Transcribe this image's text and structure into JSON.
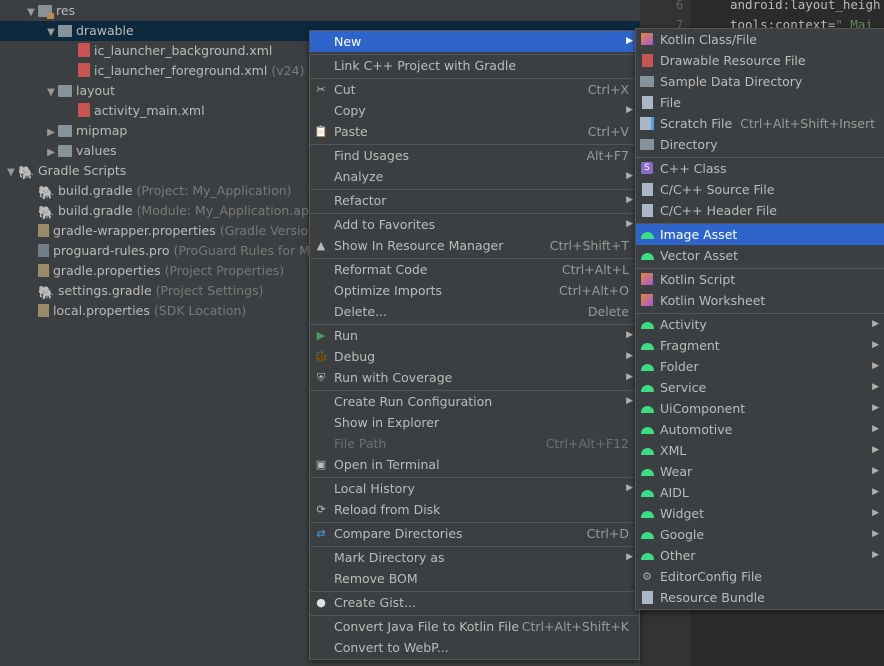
{
  "tree": {
    "rows": [
      {
        "label": "res",
        "hint": "",
        "arrow": "▼",
        "indent": 1,
        "icon": "res-folder-icon",
        "kind": "res"
      },
      {
        "label": "drawable",
        "hint": "",
        "arrow": "▼",
        "indent": 2,
        "icon": "folder-icon",
        "kind": "folder",
        "selected": true
      },
      {
        "label": "ic_launcher_background.xml",
        "hint": "",
        "arrow": "",
        "indent": 3,
        "icon": "xml-file-icon",
        "kind": "xml"
      },
      {
        "label": "ic_launcher_foreground.xml",
        "hint": "(v24)",
        "arrow": "",
        "indent": 3,
        "icon": "xml-file-icon",
        "kind": "xml"
      },
      {
        "label": "layout",
        "hint": "",
        "arrow": "▼",
        "indent": 2,
        "icon": "folder-icon",
        "kind": "folder"
      },
      {
        "label": "activity_main.xml",
        "hint": "",
        "arrow": "",
        "indent": 3,
        "icon": "xml-file-icon",
        "kind": "xml"
      },
      {
        "label": "mipmap",
        "hint": "",
        "arrow": "▶",
        "indent": 2,
        "icon": "folder-icon",
        "kind": "folder"
      },
      {
        "label": "values",
        "hint": "",
        "arrow": "▶",
        "indent": 2,
        "icon": "folder-icon",
        "kind": "folder"
      },
      {
        "label": "Gradle Scripts",
        "hint": "",
        "arrow": "▼",
        "indent": 0,
        "icon": "gradle-icon",
        "kind": "gradle"
      },
      {
        "label": "build.gradle",
        "hint": "(Project: My_Application)",
        "arrow": "",
        "indent": 1,
        "icon": "gradle-icon",
        "kind": "gradle"
      },
      {
        "label": "build.gradle",
        "hint": "(Module: My_Application.app)",
        "arrow": "",
        "indent": 1,
        "icon": "gradle-icon",
        "kind": "gradle"
      },
      {
        "label": "gradle-wrapper.properties",
        "hint": "(Gradle Version)",
        "arrow": "",
        "indent": 1,
        "icon": "properties-file-icon",
        "kind": "prop"
      },
      {
        "label": "proguard-rules.pro",
        "hint": "(ProGuard Rules for My_",
        "arrow": "",
        "indent": 1,
        "icon": "proguard-file-icon",
        "kind": "proguard"
      },
      {
        "label": "gradle.properties",
        "hint": "(Project Properties)",
        "arrow": "",
        "indent": 1,
        "icon": "properties-file-icon",
        "kind": "prop"
      },
      {
        "label": "settings.gradle",
        "hint": "(Project Settings)",
        "arrow": "",
        "indent": 1,
        "icon": "gradle-icon",
        "kind": "gradle"
      },
      {
        "label": "local.properties",
        "hint": "(SDK Location)",
        "arrow": "",
        "indent": 1,
        "icon": "properties-file-icon",
        "kind": "prop"
      }
    ]
  },
  "editor": {
    "line_numbers": [
      "6",
      "7"
    ],
    "lines": [
      {
        "text": "android:layout_heigh",
        "value": ""
      },
      {
        "text": "tools:context=",
        "value": "\" Mai"
      }
    ]
  },
  "context_menu": {
    "items": [
      {
        "label": "New",
        "shortcut": "",
        "submenu": true,
        "active": true,
        "icon": ""
      },
      {
        "sep": true
      },
      {
        "label": "Link C++ Project with Gradle",
        "shortcut": "",
        "icon": ""
      },
      {
        "sep": true
      },
      {
        "label": "Cut",
        "shortcut": "Ctrl+X",
        "icon": "scissors-icon"
      },
      {
        "label": "Copy",
        "shortcut": "",
        "submenu": true,
        "icon": ""
      },
      {
        "label": "Paste",
        "shortcut": "Ctrl+V",
        "icon": "clipboard-icon"
      },
      {
        "sep": true
      },
      {
        "label": "Find Usages",
        "shortcut": "Alt+F7",
        "icon": ""
      },
      {
        "label": "Analyze",
        "shortcut": "",
        "submenu": true,
        "icon": ""
      },
      {
        "sep": true
      },
      {
        "label": "Refactor",
        "shortcut": "",
        "submenu": true,
        "icon": ""
      },
      {
        "sep": true
      },
      {
        "label": "Add to Favorites",
        "shortcut": "",
        "submenu": true,
        "icon": ""
      },
      {
        "label": "Show In Resource Manager",
        "shortcut": "Ctrl+Shift+T",
        "icon": "resource-manager-icon"
      },
      {
        "sep": true
      },
      {
        "label": "Reformat Code",
        "shortcut": "Ctrl+Alt+L",
        "icon": ""
      },
      {
        "label": "Optimize Imports",
        "shortcut": "Ctrl+Alt+O",
        "icon": ""
      },
      {
        "label": "Delete...",
        "shortcut": "Delete",
        "icon": ""
      },
      {
        "sep": true
      },
      {
        "label": "Run",
        "shortcut": "",
        "submenu": true,
        "icon": "run-icon"
      },
      {
        "label": "Debug",
        "shortcut": "",
        "submenu": true,
        "icon": "debug-icon"
      },
      {
        "label": "Run with Coverage",
        "shortcut": "",
        "submenu": true,
        "icon": "coverage-icon"
      },
      {
        "sep": true
      },
      {
        "label": "Create Run Configuration",
        "shortcut": "",
        "submenu": true,
        "icon": ""
      },
      {
        "label": "Show in Explorer",
        "shortcut": "",
        "icon": ""
      },
      {
        "label": "File Path",
        "shortcut": "Ctrl+Alt+F12",
        "disabled": true,
        "icon": ""
      },
      {
        "label": "Open in Terminal",
        "shortcut": "",
        "icon": "terminal-icon"
      },
      {
        "sep": true
      },
      {
        "label": "Local History",
        "shortcut": "",
        "submenu": true,
        "icon": ""
      },
      {
        "label": "Reload from Disk",
        "shortcut": "",
        "icon": "reload-icon"
      },
      {
        "sep": true
      },
      {
        "label": "Compare Directories",
        "shortcut": "Ctrl+D",
        "icon": "compare-icon"
      },
      {
        "sep": true
      },
      {
        "label": "Mark Directory as",
        "shortcut": "",
        "submenu": true,
        "icon": ""
      },
      {
        "label": "Remove BOM",
        "shortcut": "",
        "icon": ""
      },
      {
        "sep": true
      },
      {
        "label": "Create Gist...",
        "shortcut": "",
        "icon": "github-icon"
      },
      {
        "sep": true
      },
      {
        "label": "Convert Java File to Kotlin File",
        "shortcut": "Ctrl+Alt+Shift+K",
        "icon": ""
      },
      {
        "label": "Convert to WebP...",
        "shortcut": "",
        "icon": ""
      }
    ]
  },
  "new_submenu": {
    "items": [
      {
        "label": "Kotlin Class/File",
        "shortcut": "",
        "icon": "kotlin-file-icon"
      },
      {
        "label": "Drawable Resource File",
        "shortcut": "",
        "icon": "resource-file-icon"
      },
      {
        "label": "Sample Data Directory",
        "shortcut": "",
        "icon": "folder-icon"
      },
      {
        "label": "File",
        "shortcut": "",
        "icon": "file-icon"
      },
      {
        "label": "Scratch File",
        "shortcut": "Ctrl+Alt+Shift+Insert",
        "icon": "scratch-file-icon"
      },
      {
        "label": "Directory",
        "shortcut": "",
        "icon": "folder-icon"
      },
      {
        "sep": true
      },
      {
        "label": "C++ Class",
        "shortcut": "",
        "icon": "cpp-class-icon"
      },
      {
        "label": "C/C++ Source File",
        "shortcut": "",
        "icon": "cpp-source-icon"
      },
      {
        "label": "C/C++ Header File",
        "shortcut": "",
        "icon": "cpp-header-icon"
      },
      {
        "sep": true
      },
      {
        "label": "Image Asset",
        "shortcut": "",
        "active": true,
        "icon": "android-icon"
      },
      {
        "label": "Vector Asset",
        "shortcut": "",
        "icon": "android-icon"
      },
      {
        "sep": true
      },
      {
        "label": "Kotlin Script",
        "shortcut": "",
        "icon": "kotlin-script-icon"
      },
      {
        "label": "Kotlin Worksheet",
        "shortcut": "",
        "icon": "kotlin-worksheet-icon"
      },
      {
        "sep": true
      },
      {
        "label": "Activity",
        "submenu": true,
        "icon": "android-icon"
      },
      {
        "label": "Fragment",
        "submenu": true,
        "icon": "android-icon"
      },
      {
        "label": "Folder",
        "submenu": true,
        "icon": "android-icon"
      },
      {
        "label": "Service",
        "submenu": true,
        "icon": "android-icon"
      },
      {
        "label": "UiComponent",
        "submenu": true,
        "icon": "android-icon"
      },
      {
        "label": "Automotive",
        "submenu": true,
        "icon": "android-icon"
      },
      {
        "label": "XML",
        "submenu": true,
        "icon": "android-icon"
      },
      {
        "label": "Wear",
        "submenu": true,
        "icon": "android-icon"
      },
      {
        "label": "AIDL",
        "submenu": true,
        "icon": "android-icon"
      },
      {
        "label": "Widget",
        "submenu": true,
        "icon": "android-icon"
      },
      {
        "label": "Google",
        "submenu": true,
        "icon": "android-icon"
      },
      {
        "label": "Other",
        "submenu": true,
        "icon": "android-icon"
      },
      {
        "label": "EditorConfig File",
        "shortcut": "",
        "icon": "gear-icon"
      },
      {
        "label": "Resource Bundle",
        "shortcut": "",
        "icon": "resource-bundle-icon"
      }
    ]
  },
  "colors": {
    "accent": "#2f65ca",
    "selection": "#0d293e",
    "android_green": "#3ddc84"
  }
}
